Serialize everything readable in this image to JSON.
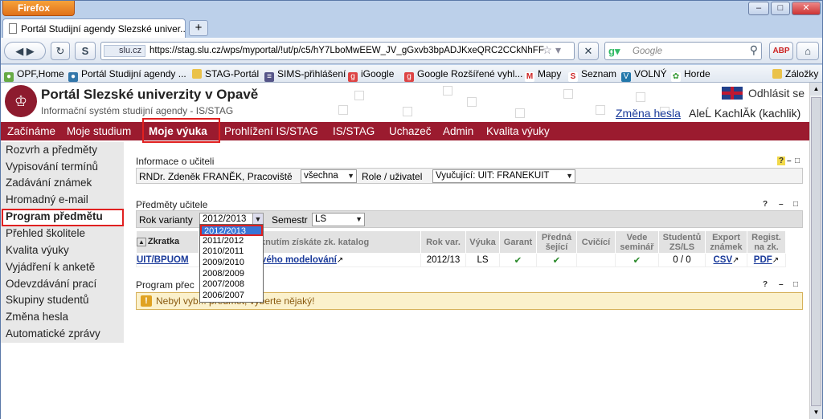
{
  "browser": {
    "app_button": "Firefox",
    "tab_title": "Portál Studijní agendy Slezské univer...",
    "new_tab": "+",
    "site_badge": "slu.cz",
    "url": "https://stag.slu.cz/wps/myportal/!ut/p/c5/hY7LboMwEEW_JV_gGxvb3bpADJKxeQRC2CCkNhFF",
    "search_placeholder": "Google",
    "bookmarks": [
      "OPF,Home",
      "Portál Studijní agendy ...",
      "STAG-Portál",
      "SIMS-přihlášení",
      "iGoogle",
      "Google Rozšířené vyhl...",
      "Mapy",
      "Seznam",
      "VOLNÝ",
      "Horde"
    ],
    "bookmarks_right": "Záložky"
  },
  "portal": {
    "title": "Portál Slezské univerzity v Opavě",
    "subtitle": "Informační systém studijní agendy - IS/STAG",
    "logout": "Odhlásit se",
    "change_password": "Změna hesla",
    "user": "AleĹ KachlĂk (kachlik)"
  },
  "menu": [
    "Začínáme",
    "Moje studium",
    "Moje výuka",
    "Prohlížení IS/STAG",
    "IS/STAG",
    "Uchazeč",
    "Admin",
    "Kvalita výuky"
  ],
  "sidebar": [
    "Rozvrh a předměty",
    "Vypisování termínů",
    "Zadávání známek",
    "Hromadný e-mail",
    "Program předmětu",
    "Přehled školitele",
    "Kvalita výuky",
    "Vyjádření k anketě",
    "Odevzdávání prací",
    "Skupiny studentů",
    "Změna hesla",
    "Automatické zprávy"
  ],
  "teacher_info": {
    "header": "Informace o učiteli",
    "name": "RNDr. Zdeněk FRANĚK, Pracoviště",
    "workplace_select": "všechna",
    "role_label": "Role / uživatel",
    "role_select": "Vyučující: UIT: FRANEKUIT"
  },
  "subjects": {
    "header": "Předměty učitele",
    "year_label": "Rok varianty",
    "year_value": "2012/2013",
    "semester_label": "Semestr",
    "semester_value": "LS",
    "columns": [
      "Zkratka",
      "kliknutím získáte zk. katalog",
      "Rok var.",
      "Výuka",
      "Garant",
      "Předná šející",
      "Cvičící",
      "Vede seminář",
      "Studentů ZS/LS",
      "Export známek",
      "Regist. na zk."
    ],
    "row": {
      "code": "UIT/BPUOM",
      "name": "vého objektového modelování",
      "year": "2012/13",
      "teaching": "LS",
      "garant": "✔",
      "lecturer": "✔",
      "exercise": "",
      "seminar": "✔",
      "students": "0 / 0",
      "export": "CSV",
      "register": "PDF"
    }
  },
  "dropdown_options": [
    "2012/2013",
    "2011/2012",
    "2010/2011",
    "2009/2010",
    "2008/2009",
    "2007/2008",
    "2006/2007"
  ],
  "program": {
    "header": "Program přec",
    "warning": "Nebyl vyb... předmět, vyberte nějaký!"
  },
  "colors": {
    "menu_bg": "#9b1b2f",
    "highlight": "#e02020",
    "warning_bg": "#fbf1cc"
  }
}
